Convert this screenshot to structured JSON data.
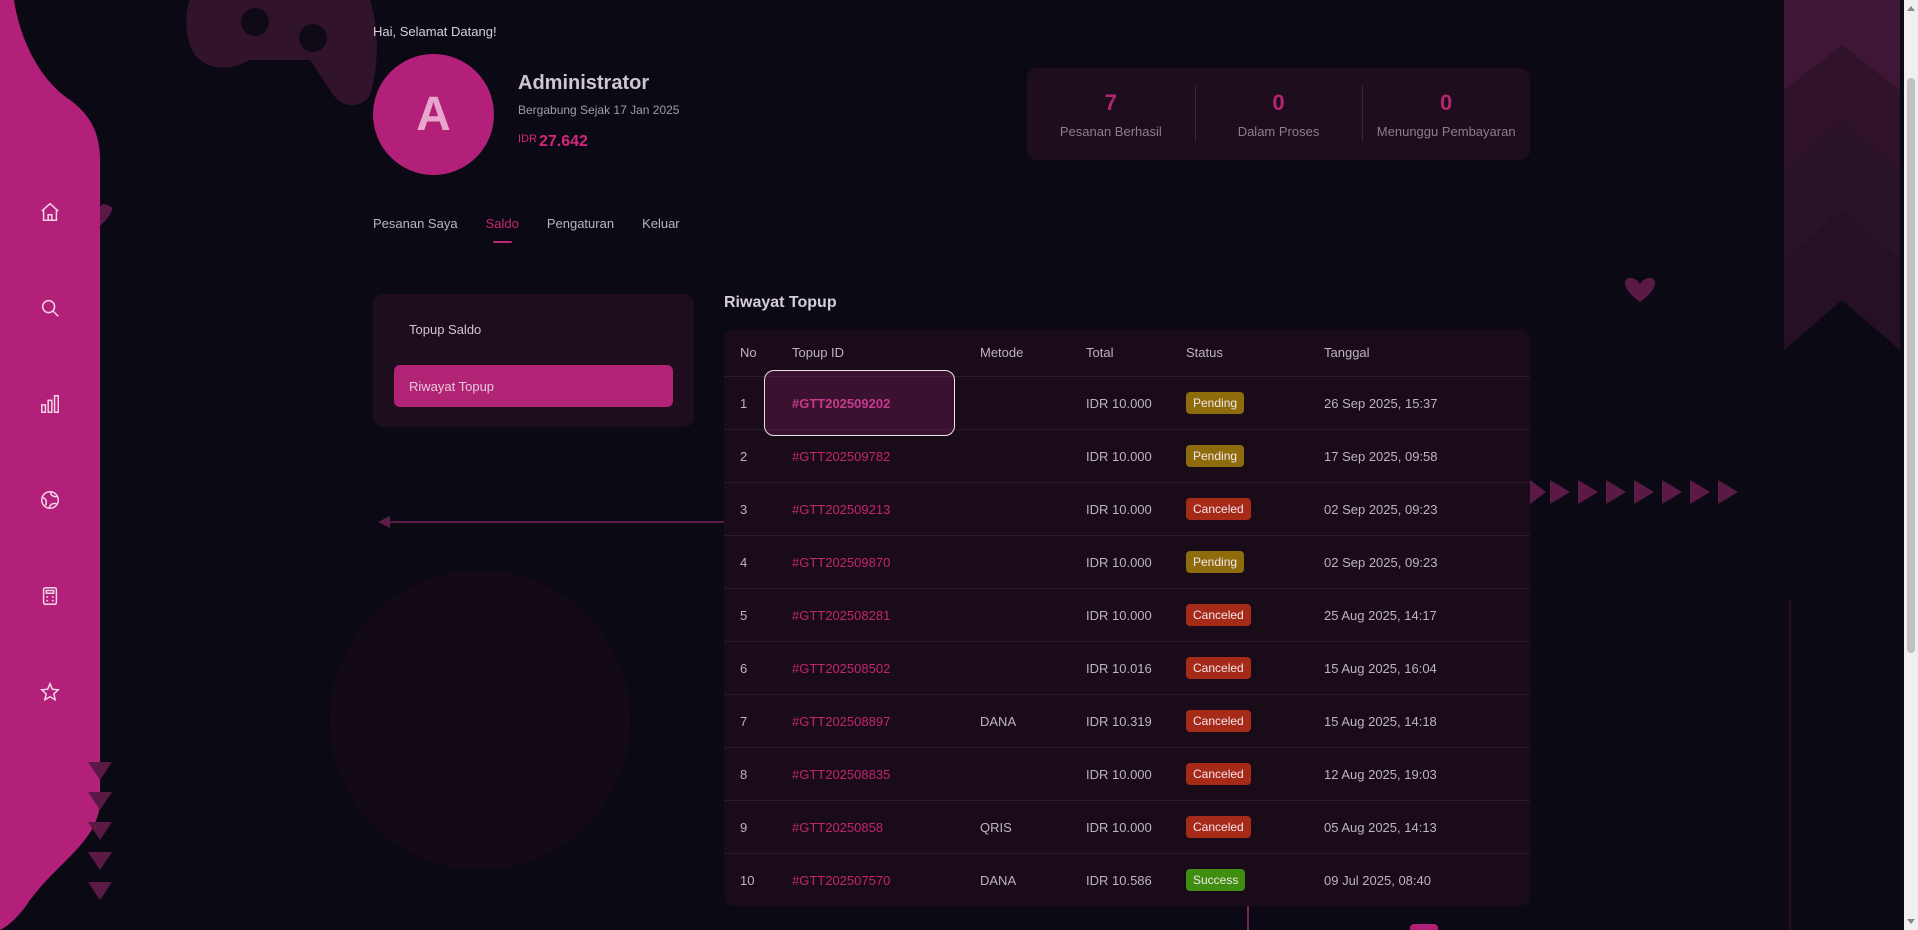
{
  "colors": {
    "accent": "#c2266f",
    "rail": "#b3207a",
    "background": "#0b0a14",
    "panel": "#1e0d1c"
  },
  "nav_icons": [
    "home-icon",
    "search-icon",
    "bar-chart-icon",
    "globe-icon",
    "calculator-icon",
    "star-icon"
  ],
  "profile": {
    "greeting": "Hai, Selamat Datang!",
    "avatar_letter": "A",
    "name": "Administrator",
    "joined": "Bergabung Sejak 17 Jan 2025",
    "balance_currency": "IDR",
    "balance_amount": "27.642"
  },
  "stats": [
    {
      "value": "7",
      "label": "Pesanan Berhasil"
    },
    {
      "value": "0",
      "label": "Dalam Proses"
    },
    {
      "value": "0",
      "label": "Menunggu Pembayaran"
    }
  ],
  "tabs": [
    {
      "label": "Pesanan Saya",
      "active": false
    },
    {
      "label": "Saldo",
      "active": true
    },
    {
      "label": "Pengaturan",
      "active": false
    },
    {
      "label": "Keluar",
      "active": false
    }
  ],
  "side_menu": [
    {
      "label": "Topup Saldo",
      "active": false
    },
    {
      "label": "Riwayat Topup",
      "active": true
    }
  ],
  "history": {
    "title": "Riwayat Topup",
    "columns": [
      "No",
      "Topup ID",
      "Metode",
      "Total",
      "Status",
      "Tanggal"
    ],
    "rows": [
      {
        "no": "1",
        "id": "#GTT202509202",
        "method": "",
        "total": "IDR 10.000",
        "status": "Pending",
        "date": "26 Sep 2025, 15:37"
      },
      {
        "no": "2",
        "id": "#GTT202509782",
        "method": "",
        "total": "IDR 10.000",
        "status": "Pending",
        "date": "17 Sep 2025, 09:58"
      },
      {
        "no": "3",
        "id": "#GTT202509213",
        "method": "",
        "total": "IDR 10.000",
        "status": "Canceled",
        "date": "02 Sep 2025, 09:23"
      },
      {
        "no": "4",
        "id": "#GTT202509870",
        "method": "",
        "total": "IDR 10.000",
        "status": "Pending",
        "date": "02 Sep 2025, 09:23"
      },
      {
        "no": "5",
        "id": "#GTT202508281",
        "method": "",
        "total": "IDR 10.000",
        "status": "Canceled",
        "date": "25 Aug 2025, 14:17"
      },
      {
        "no": "6",
        "id": "#GTT202508502",
        "method": "",
        "total": "IDR 10.016",
        "status": "Canceled",
        "date": "15 Aug 2025, 16:04"
      },
      {
        "no": "7",
        "id": "#GTT202508897",
        "method": "DANA",
        "total": "IDR 10.319",
        "status": "Canceled",
        "date": "15 Aug 2025, 14:18"
      },
      {
        "no": "8",
        "id": "#GTT202508835",
        "method": "",
        "total": "IDR 10.000",
        "status": "Canceled",
        "date": "12 Aug 2025, 19:03"
      },
      {
        "no": "9",
        "id": "#GTT20250858",
        "method": "QRIS",
        "total": "IDR 10.000",
        "status": "Canceled",
        "date": "05 Aug 2025, 14:13"
      },
      {
        "no": "10",
        "id": "#GTT202507570",
        "method": "DANA",
        "total": "IDR 10.586",
        "status": "Success",
        "date": "09 Jul 2025, 08:40"
      }
    ]
  }
}
